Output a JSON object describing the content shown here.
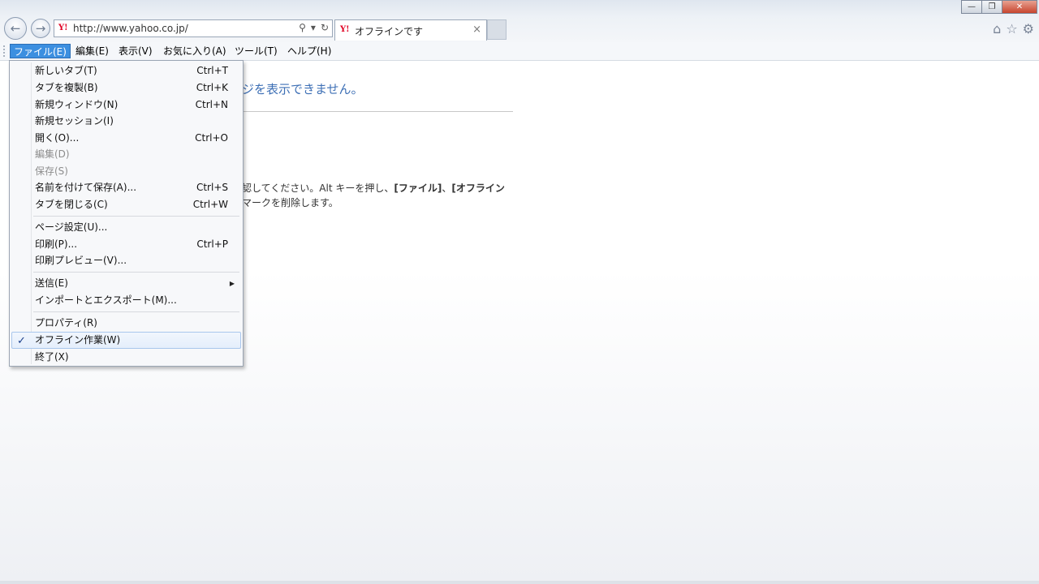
{
  "window": {
    "address_url": "http://www.yahoo.co.jp/",
    "tab_title": "オフラインです",
    "minimize": "—",
    "maximize": "❐",
    "close": "✕"
  },
  "menubar": [
    {
      "label": "ファイル(E)"
    },
    {
      "label": "編集(E)"
    },
    {
      "label": "表示(V)"
    },
    {
      "label": "お気に入り(A)"
    },
    {
      "label": "ツール(T)"
    },
    {
      "label": "ヘルプ(H)"
    }
  ],
  "page": {
    "heading": "ジを表示できません。",
    "line1_a": "認してください。Alt キーを押し、",
    "line1_b": "[ファイル]",
    "line1_c": "、",
    "line1_d": "[オフライン",
    "line2": "マークを削除します。"
  },
  "file_menu": [
    {
      "label": "新しいタブ(T)",
      "shortcut": "Ctrl+T"
    },
    {
      "label": "タブを複製(B)",
      "shortcut": "Ctrl+K"
    },
    {
      "label": "新規ウィンドウ(N)",
      "shortcut": "Ctrl+N"
    },
    {
      "label": "新規セッション(I)",
      "shortcut": ""
    },
    {
      "label": "開く(O)...",
      "shortcut": "Ctrl+O"
    },
    {
      "label": "編集(D)",
      "shortcut": ""
    },
    {
      "label": "保存(S)",
      "shortcut": ""
    },
    {
      "label": "名前を付けて保存(A)...",
      "shortcut": "Ctrl+S"
    },
    {
      "label": "タブを閉じる(C)",
      "shortcut": "Ctrl+W"
    },
    {
      "label": "ページ設定(U)...",
      "shortcut": ""
    },
    {
      "label": "印刷(P)...",
      "shortcut": "Ctrl+P"
    },
    {
      "label": "印刷プレビュー(V)...",
      "shortcut": ""
    },
    {
      "label": "送信(E)",
      "shortcut": ""
    },
    {
      "label": "インポートとエクスポート(M)...",
      "shortcut": ""
    },
    {
      "label": "プロパティ(R)",
      "shortcut": ""
    },
    {
      "label": "オフライン作業(W)",
      "shortcut": "",
      "checked": true
    },
    {
      "label": "終了(X)",
      "shortcut": ""
    }
  ],
  "icons": {
    "back": "back-arrow-icon",
    "forward": "forward-arrow-icon",
    "check": "✓",
    "submenu": "▶"
  },
  "colors": {
    "menu_active": "#3c8fe0",
    "heading": "#3d6fb5",
    "yahoo": "#e00022"
  }
}
